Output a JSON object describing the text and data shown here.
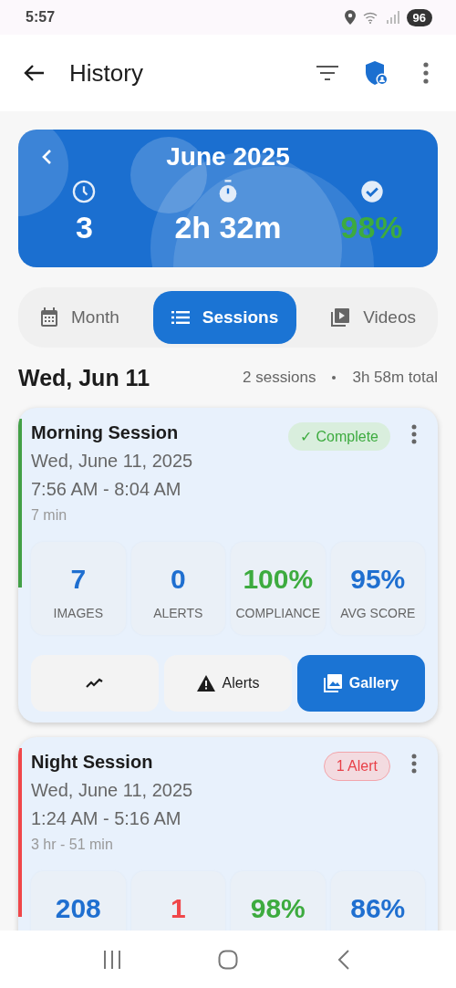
{
  "status_bar": {
    "time": "5:57",
    "battery": "96"
  },
  "app_bar": {
    "title": "History"
  },
  "summary": {
    "month": "June 2025",
    "stats": [
      {
        "kind": "clock",
        "value": "3",
        "color": "#ffffff"
      },
      {
        "kind": "timer",
        "value": "2h 32m",
        "color": "#ffffff"
      },
      {
        "kind": "check",
        "value": "98%",
        "color": "#3dab3f"
      }
    ]
  },
  "tabs": [
    {
      "kind": "calendar",
      "label": "Month",
      "selected": false
    },
    {
      "kind": "list",
      "label": "Sessions",
      "selected": true
    },
    {
      "kind": "video",
      "label": "Videos",
      "selected": false
    }
  ],
  "day": {
    "title": "Wed, Jun 11",
    "sessions": "2 sessions",
    "total": "3h 58m total"
  },
  "sessions": [
    {
      "title": "Morning Session",
      "date": "Wed, June 11, 2025",
      "time": "7:56 AM - 8:04 AM",
      "duration": "7 min",
      "color": "#43a047",
      "badge": {
        "kind": "complete",
        "label": "✓ Complete"
      },
      "stats": [
        {
          "value": "7",
          "label": "IMAGES",
          "color": "#1f6fd0"
        },
        {
          "value": "0",
          "label": "ALERTS",
          "color": "#1f6fd0"
        },
        {
          "value": "100%",
          "label": "COMPLIANCE",
          "color": "#3dab3f"
        },
        {
          "value": "95%",
          "label": "AVG SCORE",
          "color": "#1f6fd0"
        }
      ],
      "actions": [
        {
          "kind": "chart",
          "selected": false
        },
        {
          "kind": "alerts",
          "label": "Alerts",
          "selected": false
        },
        {
          "kind": "gallery",
          "label": "Gallery",
          "selected": true
        }
      ]
    },
    {
      "title": "Night Session",
      "date": "Wed, June 11, 2025",
      "time": "1:24 AM - 5:16 AM",
      "duration": "3 hr - 51 min",
      "color": "#f0474a",
      "badge": {
        "kind": "alert",
        "label": "1 Alert"
      },
      "stats": [
        {
          "value": "208",
          "color": "#1f6fd0"
        },
        {
          "value": "1",
          "color": "#f0474a"
        },
        {
          "value": "98%",
          "color": "#3dab3f"
        },
        {
          "value": "86%",
          "color": "#1f6fd0"
        }
      ]
    }
  ]
}
